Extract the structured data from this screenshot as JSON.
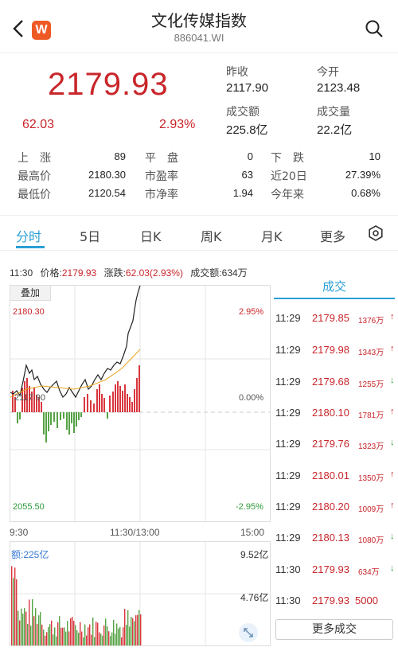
{
  "header": {
    "title": "文化传媒指数",
    "code": "886041.WI",
    "logo": "W"
  },
  "quote": {
    "price": "2179.93",
    "change": "62.03",
    "change_pct": "2.93%",
    "color_up": "#c8262b",
    "color_down": "#2e9a3b",
    "kv": [
      {
        "label": "昨收",
        "value": "2117.90"
      },
      {
        "label": "今开",
        "value": "2123.48"
      },
      {
        "label": "成交额",
        "value": "225.8亿"
      },
      {
        "label": "成交量",
        "value": "22.2亿"
      }
    ],
    "stats": [
      {
        "label": "上　涨",
        "value": "89"
      },
      {
        "label": "平　盘",
        "value": "0"
      },
      {
        "label": "下　跌",
        "value": "10"
      },
      {
        "label": "最高价",
        "value": "2180.30"
      },
      {
        "label": "市盈率",
        "value": "63"
      },
      {
        "label": "近20日",
        "value": "27.39%"
      },
      {
        "label": "最低价",
        "value": "2120.54"
      },
      {
        "label": "市净率",
        "value": "1.94"
      },
      {
        "label": "今年来",
        "value": "0.68%"
      }
    ]
  },
  "tabs": [
    "分时",
    "5日",
    "日K",
    "周K",
    "月K",
    "更多"
  ],
  "active_tab": "分时",
  "info_bar": {
    "time": "11:30",
    "price_label": "价格:",
    "price": "2179.93",
    "chg_label": "涨跌:",
    "chg": "62.03(2.93%)",
    "amount_label": "成交额:",
    "amount": "634万"
  },
  "chart": {
    "overlay_label": "叠加",
    "y_top": "2180.30",
    "y_mid": "2117.90",
    "y_bottom": "2055.50",
    "pct_top": "2.95%",
    "pct_mid": "0.00%",
    "pct_bottom": "-2.95%",
    "time_start": "9:30",
    "time_mid": "11:30/13:00",
    "time_end": "15:00",
    "vol_label": "额:225亿",
    "vol_top": "9.52亿",
    "vol_mid": "4.76亿"
  },
  "trades": {
    "header": "成交",
    "more_label": "更多成交",
    "rows": [
      {
        "time": "11:29",
        "price": "2179.85",
        "vol": "1376万",
        "dir": "up"
      },
      {
        "time": "11:29",
        "price": "2179.98",
        "vol": "1343万",
        "dir": "up"
      },
      {
        "time": "11:29",
        "price": "2179.68",
        "vol": "1255万",
        "dir": "down"
      },
      {
        "time": "11:29",
        "price": "2180.10",
        "vol": "1781万",
        "dir": "up"
      },
      {
        "time": "11:29",
        "price": "2179.76",
        "vol": "1323万",
        "dir": "down"
      },
      {
        "time": "11:29",
        "price": "2180.01",
        "vol": "1350万",
        "dir": "up"
      },
      {
        "time": "11:29",
        "price": "2180.20",
        "vol": "1009万",
        "dir": "up"
      },
      {
        "time": "11:29",
        "price": "2180.13",
        "vol": "1080万",
        "dir": "down"
      },
      {
        "time": "11:30",
        "price": "2179.93",
        "vol": "634万",
        "dir": "down"
      },
      {
        "time": "11:30",
        "price": "2179.93",
        "vol": "5000",
        "dir": "none"
      }
    ]
  }
}
